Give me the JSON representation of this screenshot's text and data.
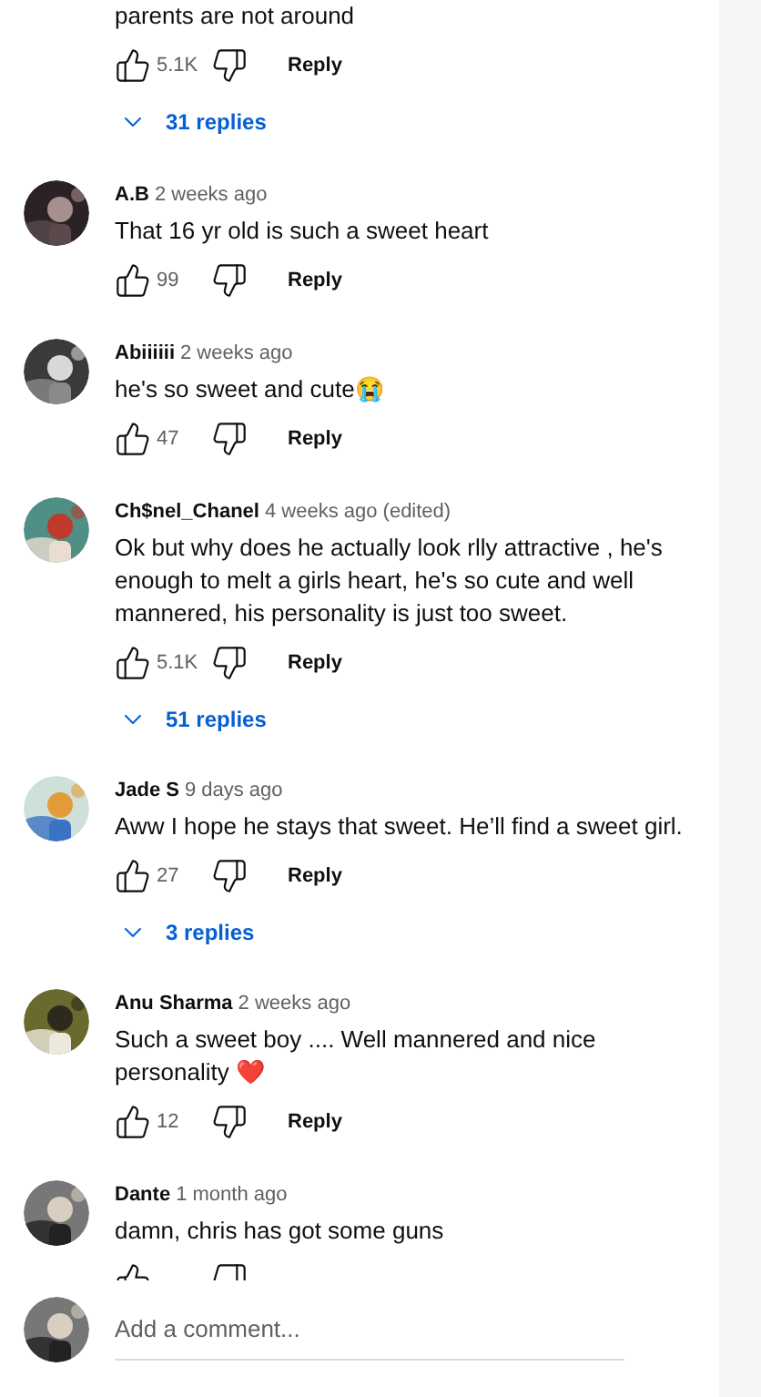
{
  "comments": [
    {
      "text": "parents are not around",
      "likes": "5.1K",
      "reply": "Reply",
      "replies": "31 replies"
    },
    {
      "author": "A.B",
      "time": "2 weeks ago",
      "text": "That 16 yr old is such a sweet heart",
      "likes": "99",
      "reply": "Reply"
    },
    {
      "author": "Abiiiiii",
      "time": "2 weeks ago",
      "text": "he's so sweet and cute😭",
      "likes": "47",
      "reply": "Reply"
    },
    {
      "author": "Ch$nel_Chanel",
      "time": "4 weeks ago (edited)",
      "text": "Ok but why does he actually look rlly attractive , he's enough to melt a girls heart, he's so cute and well mannered, his personality is just too sweet.",
      "likes": "5.1K",
      "reply": "Reply",
      "replies": "51 replies"
    },
    {
      "author": "Jade S",
      "time": "9 days ago",
      "text": "Aww I hope he stays that sweet. He’ll find a sweet girl.",
      "likes": "27",
      "reply": "Reply",
      "replies": "3 replies"
    },
    {
      "author": "Anu Sharma",
      "time": "2 weeks ago",
      "text": "Such a sweet boy .... Well mannered and nice personality ❤️",
      "likes": "12",
      "reply": "Reply"
    },
    {
      "author": "Dante",
      "time": "1 month ago",
      "text": "damn, chris has got some guns"
    }
  ],
  "add_comment": {
    "placeholder": "Add a comment..."
  }
}
